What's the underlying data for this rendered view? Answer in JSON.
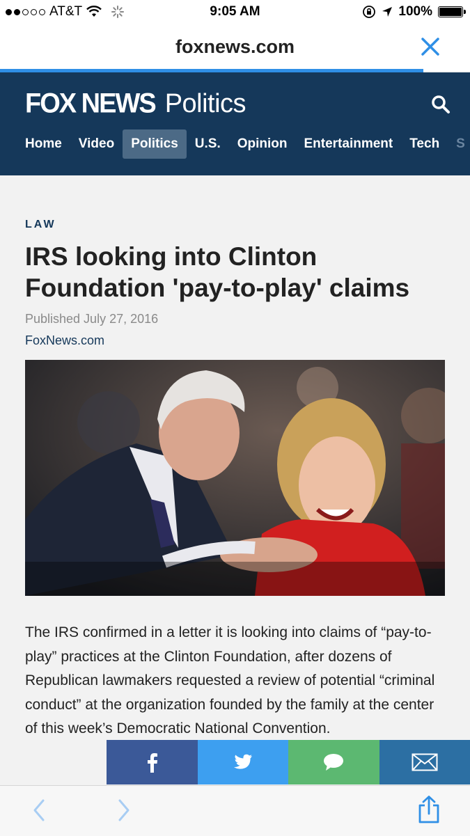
{
  "status_bar": {
    "carrier": "AT&T",
    "time": "9:05 AM",
    "battery": "100%"
  },
  "browser": {
    "domain": "foxnews.com",
    "close_icon": "close-icon",
    "back_icon": "chevron-left-icon",
    "forward_icon": "chevron-right-icon",
    "share_icon": "share-icon",
    "load_progress": 0.9
  },
  "site": {
    "brand": "FOX NEWS",
    "section": "Politics",
    "search_icon": "search-icon",
    "nav": [
      {
        "label": "Home"
      },
      {
        "label": "Video"
      },
      {
        "label": "Politics",
        "active": true
      },
      {
        "label": "U.S."
      },
      {
        "label": "Opinion"
      },
      {
        "label": "Entertainment"
      },
      {
        "label": "Tech"
      },
      {
        "label": "S"
      }
    ]
  },
  "article": {
    "category": "LAW",
    "headline": "IRS looking into Clinton Foundation 'pay-to-play' claims",
    "published": "Published July 27, 2016",
    "source": "FoxNews.com",
    "body": "The IRS confirmed in a letter it is looking into claims of “pay-to-play” practices at the Clinton Foundation, after dozens of Republican lawmakers requested a review of potential “criminal conduct” at the organization founded by the family at the center of this week’s Democratic National Convention."
  },
  "share": {
    "buttons": [
      {
        "icon": "facebook-icon",
        "color": "#3b5998"
      },
      {
        "icon": "twitter-icon",
        "color": "#3d9ff0"
      },
      {
        "icon": "message-icon",
        "color": "#5cb871"
      },
      {
        "icon": "mail-icon",
        "color": "#2c6fa3"
      }
    ]
  },
  "colors": {
    "header": "#15385a",
    "accent": "#2f8fe6"
  }
}
